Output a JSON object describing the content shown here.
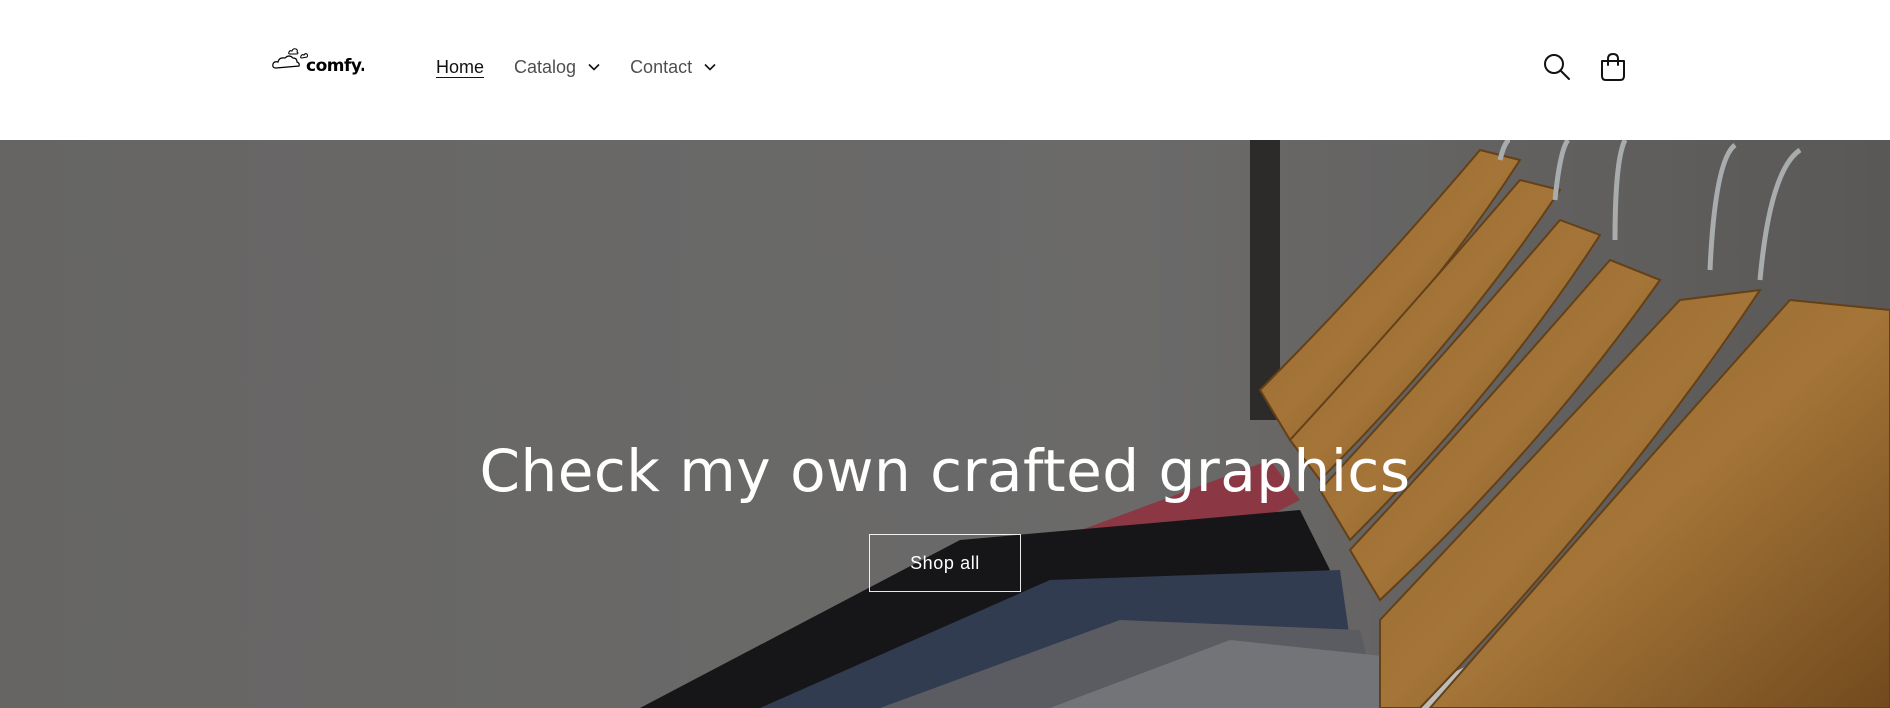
{
  "brand": {
    "logo_text": "comfy."
  },
  "nav": {
    "items": [
      {
        "label": "Home",
        "active": true,
        "dropdown": false
      },
      {
        "label": "Catalog",
        "active": false,
        "dropdown": true
      },
      {
        "label": "Contact",
        "active": false,
        "dropdown": true
      }
    ]
  },
  "header_icons": {
    "search": "search-icon",
    "cart": "cart-icon"
  },
  "hero": {
    "title": "Check my own crafted graphics",
    "button_label": "Shop all"
  },
  "colors": {
    "text": "#121212",
    "hero_overlay_bg": "#7a7977",
    "white": "#ffffff"
  }
}
